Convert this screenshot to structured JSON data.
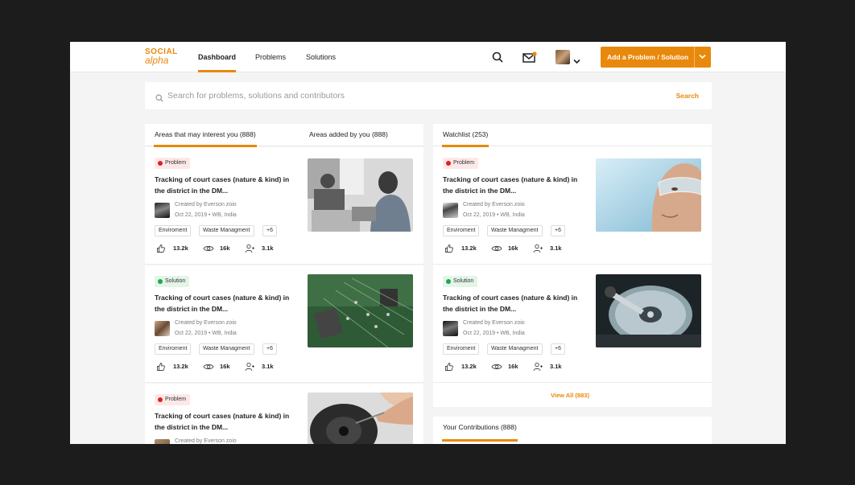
{
  "header": {
    "logo_line1": "SOCIAL",
    "logo_line2": "alpha",
    "nav": [
      "Dashboard",
      "Problems",
      "Solutions"
    ],
    "add_button": "Add a Problem / Solution",
    "accent": "#e8890c"
  },
  "search": {
    "placeholder": "Search for problems, solutions and contributors",
    "button": "Search"
  },
  "left_panel": {
    "tabs": [
      "Areas that may interest you (888)",
      "Areas added by you (888)"
    ],
    "cards": [
      {
        "type": "Problem",
        "title": "Tracking of court cases (nature & kind) in the district in the DM...",
        "created": "Created by Everson zoio",
        "meta": "Oct 22, 2019 • WB, India",
        "tags": [
          "Enviroment",
          "Waste Managment",
          "+6"
        ],
        "likes": "13.2k",
        "views": "16k",
        "users": "3.1k",
        "image": "office-people-laptops"
      },
      {
        "type": "Solution",
        "title": "Tracking of court cases (nature & kind) in the district in the DM...",
        "created": "Created by Everson zoio",
        "meta": "Oct 22, 2019 • WB, India",
        "tags": [
          "Enviroment",
          "Waste Managment",
          "+6"
        ],
        "likes": "13.2k",
        "views": "16k",
        "users": "3.1k",
        "image": "circuit-board"
      },
      {
        "type": "Problem",
        "title": "Tracking of court cases (nature & kind) in the district in the DM...",
        "created": "Created by Everson zoio",
        "meta": "",
        "tags": [],
        "likes": "",
        "views": "",
        "users": "",
        "image": "hand-repairing-device"
      }
    ]
  },
  "watchlist": {
    "tab": "Watchlist (253)",
    "cards": [
      {
        "type": "Problem",
        "title": "Tracking of court cases (nature & kind) in the district in the DM...",
        "created": "Created by Everson zoio",
        "meta": "Oct 22, 2019 • WB, India",
        "tags": [
          "Enviroment",
          "Waste Managment",
          "+6"
        ],
        "likes": "13.2k",
        "views": "16k",
        "users": "3.1k",
        "image": "woman-safety-goggles"
      },
      {
        "type": "Solution",
        "title": "Tracking of court cases (nature & kind) in the district in the DM...",
        "created": "Created by Everson zoio",
        "meta": "Oct 22, 2019 • WB, India",
        "tags": [
          "Enviroment",
          "Waste Managment",
          "+6"
        ],
        "likes": "13.2k",
        "views": "16k",
        "users": "3.1k",
        "image": "hard-disk-drive"
      }
    ],
    "view_all": "View All (883)"
  },
  "contributions": {
    "tab": "Your Contributions (888)"
  }
}
